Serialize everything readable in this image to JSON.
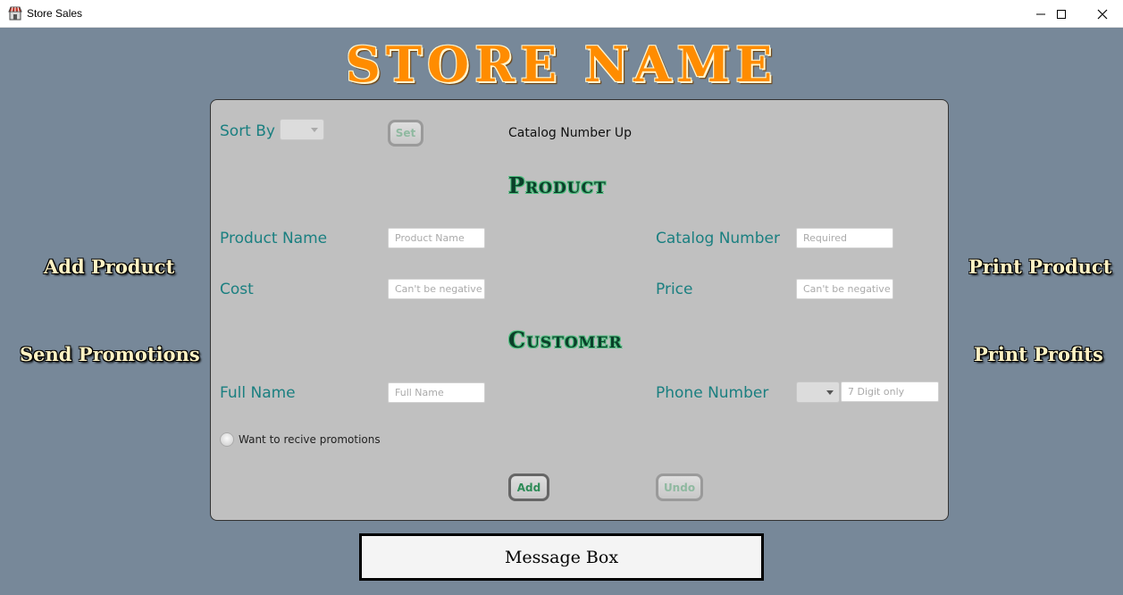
{
  "window": {
    "title": "Store Sales",
    "icon": "store-icon"
  },
  "store_name": "STORE NAME",
  "side_actions": {
    "add_product": "Add Product",
    "send_promotions": "Send Promotions",
    "print_product": "Print Product",
    "print_profits": "Print Profits"
  },
  "sort": {
    "label": "Sort By",
    "set_label": "Set",
    "current": "Catalog Number Up"
  },
  "product": {
    "heading": "Product",
    "name_label": "Product Name",
    "name_placeholder": "Product Name",
    "catalog_label": "Catalog Number",
    "catalog_placeholder": "Required",
    "cost_label": "Cost",
    "cost_placeholder": "Can't be negative",
    "price_label": "Price",
    "price_placeholder": "Can't be negative"
  },
  "customer": {
    "heading": "Customer",
    "full_name_label": "Full Name",
    "full_name_placeholder": "Full Name",
    "phone_label": "Phone Number",
    "phone_placeholder": "7 Digit only",
    "promotions_label": "Want to recive promotions"
  },
  "buttons": {
    "add": "Add",
    "undo": "Undo"
  },
  "message_box": "Message Box",
  "colors": {
    "background": "#778899",
    "panel": "#c0c0c0",
    "label": "#1a7f80",
    "store_name": "#ff8c00"
  }
}
